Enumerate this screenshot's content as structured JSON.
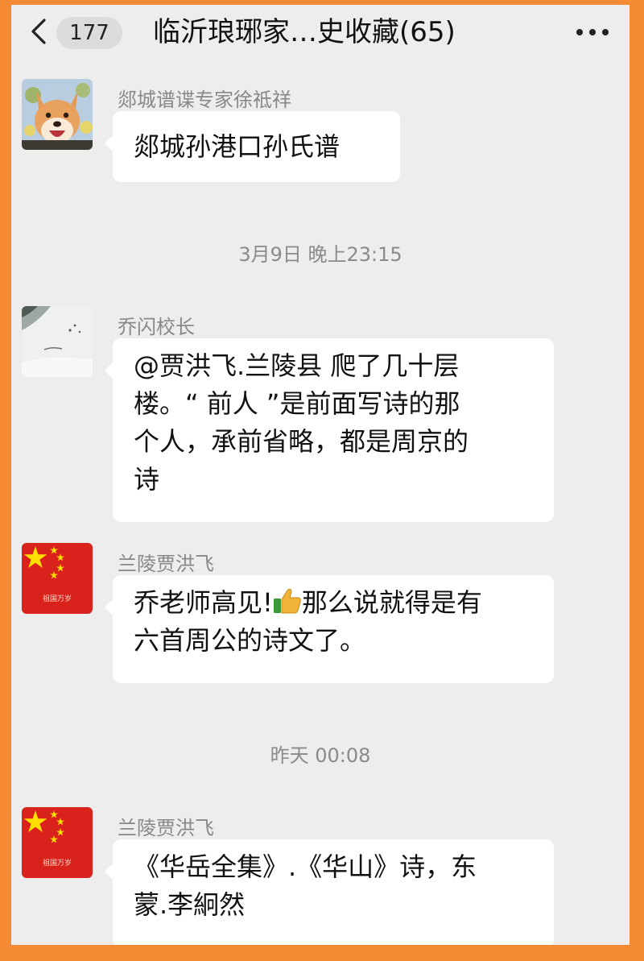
{
  "header": {
    "unread_count": "177",
    "title": "临沂琅琊家…史收藏(65)"
  },
  "messages": [
    {
      "sender": "郯城谱谍专家徐祗祥",
      "lines": [
        "郯城孙港口孙氏谱"
      ],
      "avatar": "dog-photo-avatar"
    },
    {
      "sender": "乔闪校长",
      "lines": [
        "@贾洪飞.兰陵县  爬了几十层",
        "楼。“ 前人 ”是前面写诗的那",
        "个人，承前省略，都是周京的",
        "诗"
      ],
      "avatar": "ink-landscape-avatar"
    },
    {
      "sender": "兰陵贾洪飞",
      "line1_before": "乔老师高见!",
      "line1_after": "那么说就得是有",
      "line2": "六首周公的诗文了。",
      "avatar_caption": "祖国万岁",
      "emoji": "thumbs-up-icon"
    },
    {
      "sender": "兰陵贾洪飞",
      "lines": [
        "《华岳全集》.《华山》诗，东",
        "蒙.李絅然"
      ],
      "avatar_caption": "祖国万岁"
    }
  ],
  "timestamps": [
    "3月9日 晚上23:15",
    "昨天 00:08"
  ],
  "colors": {
    "frame": "#f48a34",
    "background": "#ededed",
    "bubble": "#ffffff",
    "flag_red": "#de2910",
    "flag_star": "#ffde00"
  }
}
